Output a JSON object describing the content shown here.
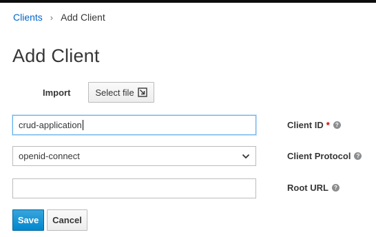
{
  "breadcrumb": {
    "parent": "Clients",
    "separator": "›",
    "current": "Add Client"
  },
  "page": {
    "title": "Add Client"
  },
  "import": {
    "label": "Import",
    "button_label": "Select file",
    "button_icon": "import-file-icon"
  },
  "form": {
    "client_id": {
      "label": "Client ID",
      "required_mark": "*",
      "value": "crud-application",
      "help_icon": "question-circle-icon"
    },
    "client_protocol": {
      "label": "Client Protocol",
      "selected": "openid-connect",
      "help_icon": "question-circle-icon"
    },
    "root_url": {
      "label": "Root URL",
      "value": "",
      "help_icon": "question-circle-icon"
    }
  },
  "actions": {
    "save_label": "Save",
    "cancel_label": "Cancel"
  },
  "colors": {
    "link": "#0066cc",
    "primary": "#0088ce",
    "required": "#cc0000",
    "focus_border": "#66afe9"
  }
}
